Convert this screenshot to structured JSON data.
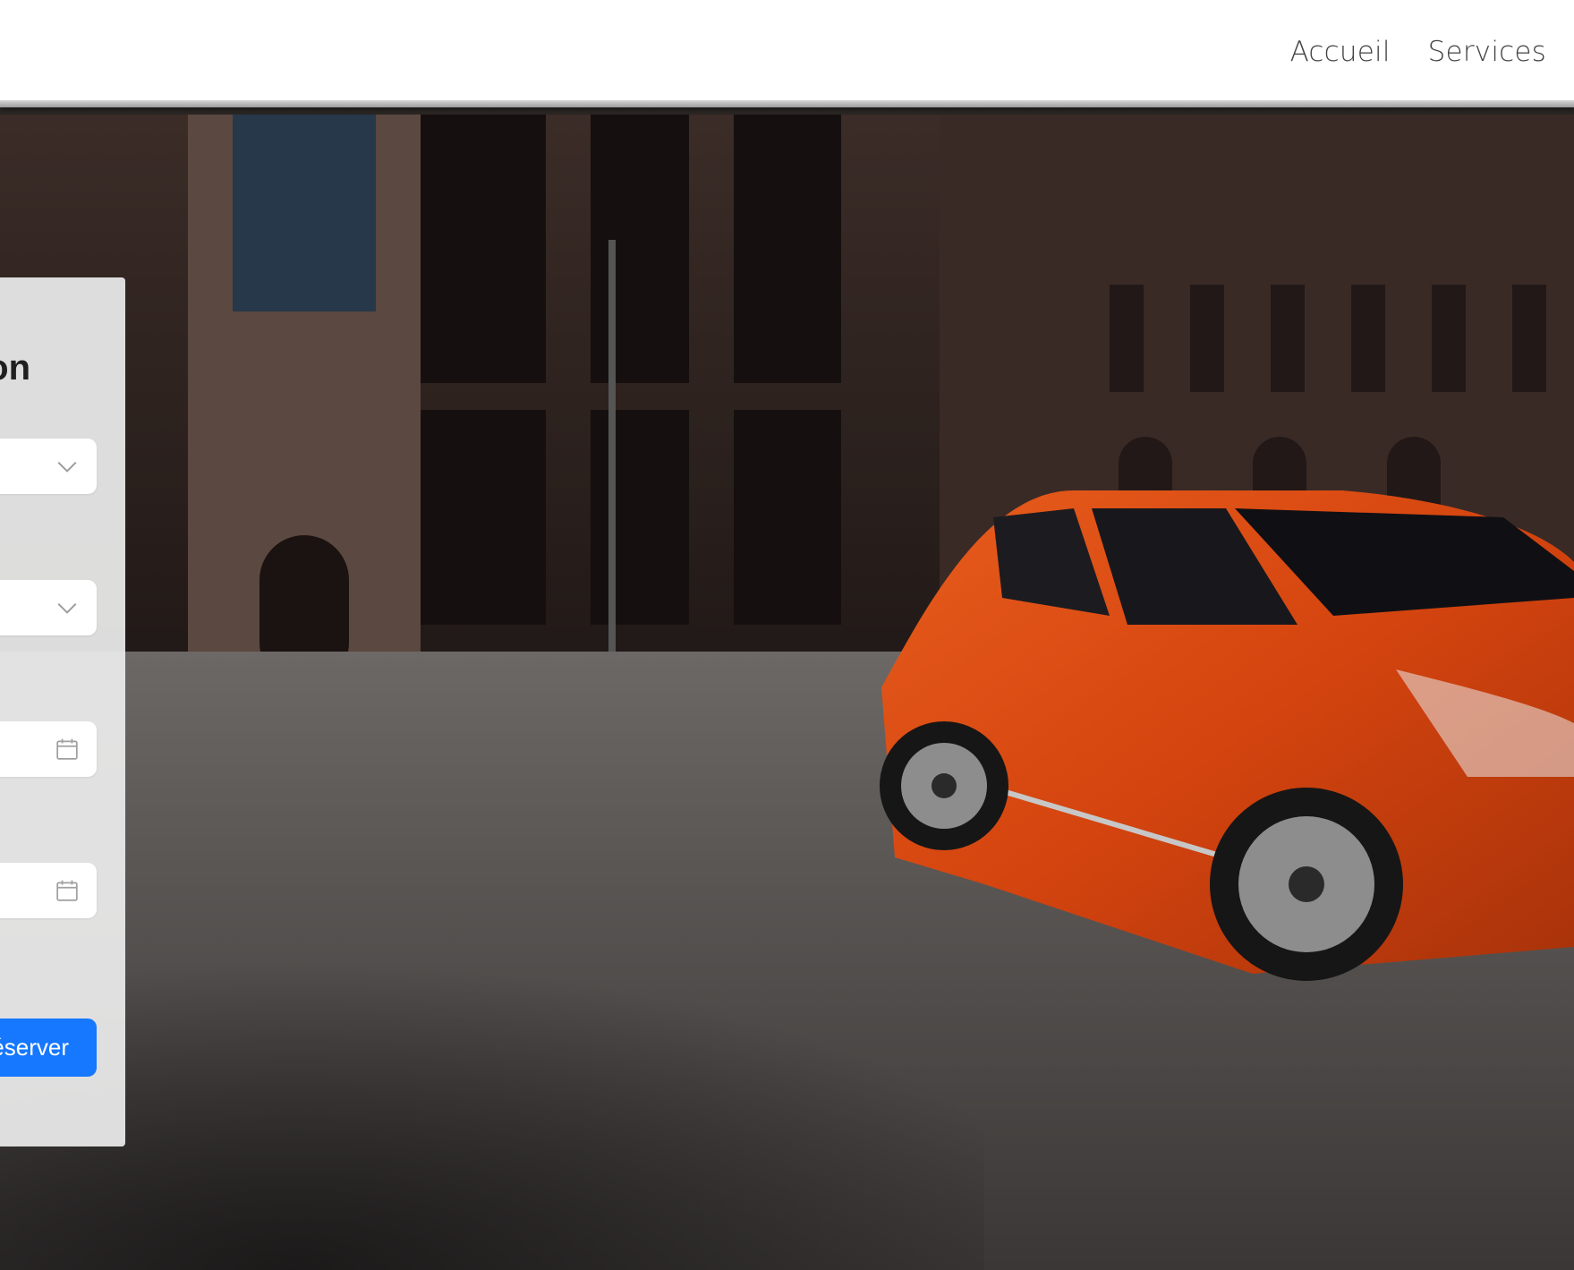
{
  "nav": {
    "items": [
      "Accueil",
      "Services"
    ]
  },
  "booking": {
    "title": "Réservation",
    "fields": [
      {
        "type": "select",
        "icon": "chevron-down-icon"
      },
      {
        "type": "select",
        "icon": "chevron-down-icon"
      },
      {
        "type": "date",
        "icon": "calendar-icon"
      },
      {
        "type": "date",
        "icon": "calendar-icon"
      }
    ],
    "submit_label": "Réserver"
  },
  "colors": {
    "primary": "#1677ff",
    "car": "#d84a12"
  }
}
